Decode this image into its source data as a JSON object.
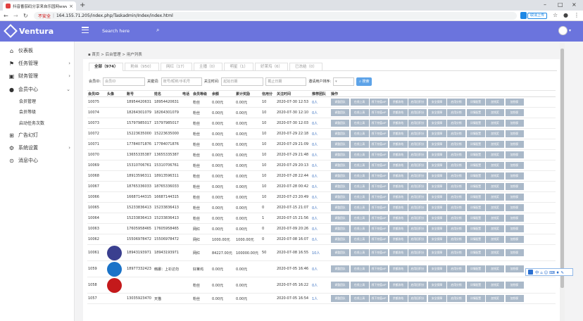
{
  "browser": {
    "tab_title": "抖音番茄码分享来自乐园网www",
    "url_warning": "不安全",
    "url": "164.155.71.205/index.php/Taskadmin/Index/index.html",
    "translate_label": "取消上传"
  },
  "app": {
    "brand": "Ventura",
    "search_label": "Search here"
  },
  "sidebar": {
    "items": [
      {
        "label": "仪表板",
        "icon": "home-icon"
      },
      {
        "label": "任务管理",
        "icon": "flag-icon"
      },
      {
        "label": "财务管理",
        "icon": "money-icon"
      },
      {
        "label": "会员中心",
        "icon": "user-icon"
      },
      {
        "label": "会员管理"
      },
      {
        "label": "会员等级"
      },
      {
        "label": "启动任务次数"
      },
      {
        "label": "广告幻灯",
        "icon": "grid-icon"
      },
      {
        "label": "系统设置",
        "icon": "gear-icon"
      },
      {
        "label": "消息中心",
        "icon": "message-icon"
      }
    ]
  },
  "breadcrumb": [
    "首页",
    "后台管理",
    "用户列表"
  ],
  "tabs": [
    "全部（974）",
    "粉丝（950）",
    "网红（17）",
    "主播（0）",
    "明星（1）",
    "好莱坞（6）",
    "已冻结（0）"
  ],
  "filters": {
    "member_id_label": "会员ID:",
    "member_id_placeholder": "会员ID",
    "keyword_label": "关键词:",
    "keyword_placeholder": "账号/昵称/手机号",
    "time_label": "关注时间:",
    "start_placeholder": "起始日期",
    "end_placeholder": "截止日期",
    "sort_label": "邀请用户排序:",
    "search_button": "搜索"
  },
  "table": {
    "headers": [
      "会员ID",
      "头像",
      "账号",
      "姓名",
      "电话",
      "会员等级",
      "余额",
      "累计奖励",
      "信用分",
      "关注时间",
      "推荐团队",
      "操作"
    ],
    "actions": [
      "调整团队",
      "在线上清",
      "线下充值vIP",
      "余额冻结",
      "启用旧积分",
      "安全保障",
      "启用分销",
      "详情配置",
      "加钱奖",
      "加钱保"
    ],
    "rows": [
      {
        "id": "10075",
        "account": "18954420631",
        "name": "18954420631",
        "phone": "",
        "level": "粉丝",
        "balance": "0.00元",
        "reward": "0.00元",
        "credit": "10",
        "time": "2020-07-30 12:53",
        "team": "0人"
      },
      {
        "id": "10074",
        "account": "18264301079",
        "name": "18264301079",
        "phone": "",
        "level": "粉丝",
        "balance": "0.00元",
        "reward": "0.00元",
        "credit": "10",
        "time": "2020-07-30 12:10",
        "team": "0人"
      },
      {
        "id": "10073",
        "account": "15797985017",
        "name": "15797985017",
        "phone": "",
        "level": "粉丝",
        "balance": "0.00元",
        "reward": "0.00元",
        "credit": "10",
        "time": "2020-07-30 12:03",
        "team": "0人"
      },
      {
        "id": "10072",
        "account": "15223635000",
        "name": "15223635000",
        "phone": "",
        "level": "粉丝",
        "balance": "0.00元",
        "reward": "0.00元",
        "credit": "10",
        "time": "2020-07-29 22:18",
        "team": "0人"
      },
      {
        "id": "10071",
        "account": "17784071876",
        "name": "17784071876",
        "phone": "",
        "level": "粉丝",
        "balance": "0.00元",
        "reward": "0.00元",
        "credit": "10",
        "time": "2020-07-29 21:09",
        "team": "0人"
      },
      {
        "id": "10070",
        "account": "13655335387",
        "name": "13655335387",
        "phone": "",
        "level": "粉丝",
        "balance": "0.00元",
        "reward": "0.00元",
        "credit": "10",
        "time": "2020-07-29 21:48",
        "team": "0人"
      },
      {
        "id": "10069",
        "account": "15310706761",
        "name": "15310706761",
        "phone": "",
        "level": "粉丝",
        "balance": "0.00元",
        "reward": "0.00元",
        "credit": "10",
        "time": "2020-07-29 20:13",
        "team": "0人"
      },
      {
        "id": "10068",
        "account": "18913596311",
        "name": "18913596311",
        "phone": "",
        "level": "粉丝",
        "balance": "0.00元",
        "reward": "0.00元",
        "credit": "10",
        "time": "2020-07-28 22:44",
        "team": "0人"
      },
      {
        "id": "10067",
        "account": "18765336033",
        "name": "18765336033",
        "phone": "",
        "level": "粉丝",
        "balance": "0.00元",
        "reward": "0.00元",
        "credit": "10",
        "time": "2020-07-28 00:42",
        "team": "0人"
      },
      {
        "id": "10066",
        "account": "16687144315",
        "name": "16687144315",
        "phone": "",
        "level": "粉丝",
        "balance": "0.00元",
        "reward": "0.00元",
        "credit": "10",
        "time": "2020-07-23 20:49",
        "team": "0人"
      },
      {
        "id": "10065",
        "account": "15233836413",
        "name": "15233836413",
        "phone": "",
        "level": "粉丝",
        "balance": "0.00元",
        "reward": "0.00元",
        "credit": "0",
        "time": "2020-07-15 21:07",
        "team": "0人"
      },
      {
        "id": "10064",
        "account": "15233836413",
        "name": "15233836413",
        "phone": "",
        "level": "粉丝",
        "balance": "0.00元",
        "reward": "0.00元",
        "credit": "1",
        "time": "2020-07-15 21:56",
        "team": "0人"
      },
      {
        "id": "10063",
        "account": "17605958465",
        "name": "17605958465",
        "phone": "",
        "level": "网红",
        "balance": "0.00元",
        "reward": "0.00元",
        "credit": "0",
        "time": "2020-07-09 20:26",
        "team": "0人"
      },
      {
        "id": "10062",
        "account": "15506978472",
        "name": "15506978472",
        "phone": "",
        "level": "网红",
        "balance": "1000.00元",
        "reward": "1000.00元",
        "credit": "0",
        "time": "2020-07-08 16:07",
        "team": "0人"
      },
      {
        "id": "10061",
        "account": "18943193971",
        "name": "18943193971",
        "phone": "",
        "level": "网红",
        "balance": "84227.00元",
        "reward": "100000.00元",
        "credit": "50",
        "time": "2020-07-08 16:55",
        "team": "10人",
        "avatar": "#3a3f8f"
      },
      {
        "id": "1059",
        "account": "18977332423",
        "name": "韩娜：上衫达勿",
        "phone": "",
        "level": "好莱坞",
        "balance": "0.00元",
        "reward": "0.00元",
        "credit": "",
        "time": "2020-07-05 16:46",
        "team": "0人",
        "avatar": "#1a73c8"
      },
      {
        "id": "1058",
        "account": "",
        "name": "",
        "phone": "",
        "level": "粉丝",
        "balance": "0.00元",
        "reward": "0.00元",
        "credit": "",
        "time": "2020-07-05 16:22",
        "team": "0人",
        "avatar": "#c4191b"
      },
      {
        "id": "1057",
        "account": "13035923470",
        "name": "天猫",
        "phone": "",
        "level": "粉丝",
        "balance": "0.00元",
        "reward": "0.00元",
        "credit": "",
        "time": "2020-07-05 16:54",
        "team": "1人"
      }
    ]
  },
  "floatbar": {
    "label": "中 ⌂ ☺ ⌨ ♦ ✎"
  }
}
